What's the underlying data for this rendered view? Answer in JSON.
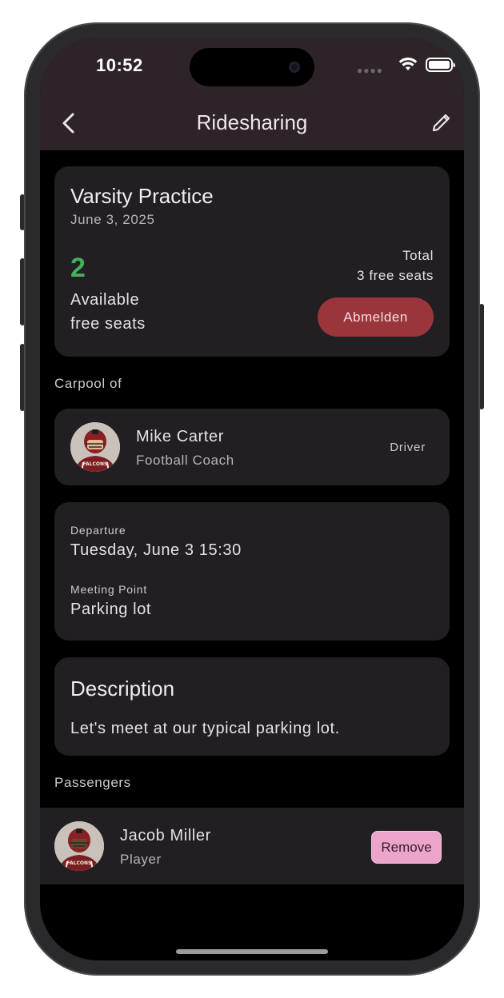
{
  "status_bar": {
    "time": "10:52"
  },
  "header": {
    "title": "Ridesharing"
  },
  "event": {
    "title": "Varsity Practice",
    "date": "June 3, 2025",
    "available_count": "2",
    "available_label_1": "Available",
    "available_label_2": "free seats",
    "total_label": "Total",
    "total_value": "3 free seats",
    "unregister_label": "Abmelden"
  },
  "carpool": {
    "section_title": "Carpool of",
    "driver_name": "Mike Carter",
    "driver_role": "Football Coach",
    "driver_tag": "Driver",
    "jersey": "FALCONS"
  },
  "trip": {
    "departure_label": "Departure",
    "departure_value": "Tuesday, June 3 15:30",
    "meeting_label": "Meeting Point",
    "meeting_value": "Parking lot"
  },
  "description": {
    "title": "Description",
    "text": "Let's meet at our typical parking lot."
  },
  "passengers": {
    "section_title": "Passengers",
    "items": [
      {
        "name": "Jacob Miller",
        "role": "Player",
        "action": "Remove",
        "jersey": "FALCONS"
      }
    ]
  },
  "colors": {
    "accent_green": "#43b05c",
    "unregister_button": "#9a353b",
    "remove_button": "#eba5cb",
    "app_bar": "#2d2329"
  }
}
